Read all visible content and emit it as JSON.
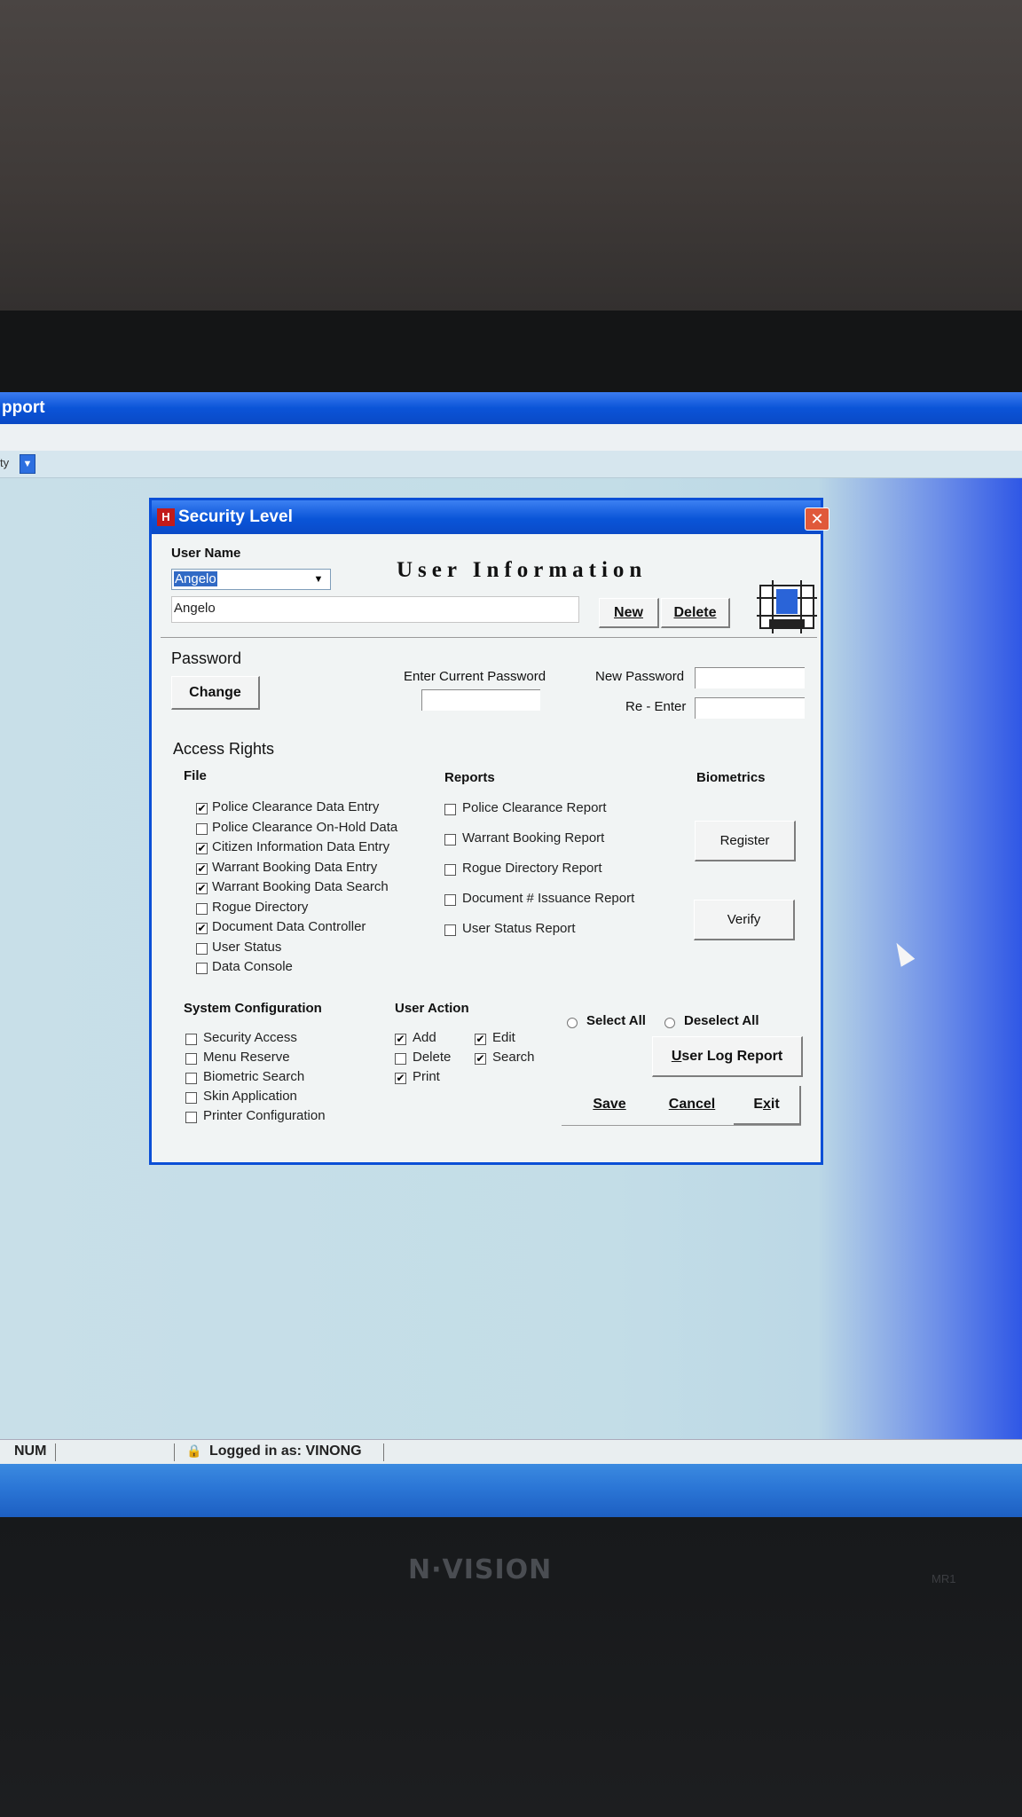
{
  "app": {
    "title": "pport",
    "toolbar_text": "ty",
    "toolbar_button_glyph": "▼"
  },
  "dialog": {
    "title": "Security Level",
    "close_glyph": "✕",
    "icon_glyph": "H",
    "user_name_label": "User Name",
    "user_name_selected": "Angelo",
    "user_name_field": "Angelo",
    "heading": "User Information",
    "new_button": "New",
    "delete_button": "Delete",
    "password_label": "Password",
    "change_button": "Change",
    "enter_current_password_label": "Enter Current Password",
    "new_password_label": "New Password",
    "reenter_label": "Re - Enter",
    "access_rights_label": "Access Rights",
    "file_label": "File",
    "reports_label": "Reports",
    "biometrics_label": "Biometrics",
    "register_button": "Register",
    "verify_button": "Verify",
    "file_items": [
      {
        "label": "Police Clearance Data Entry",
        "checked": true
      },
      {
        "label": "Police Clearance On-Hold Data",
        "checked": false
      },
      {
        "label": "Citizen Information Data Entry",
        "checked": true
      },
      {
        "label": "Warrant Booking Data Entry",
        "checked": true
      },
      {
        "label": "Warrant Booking Data Search",
        "checked": true
      },
      {
        "label": "Rogue Directory",
        "checked": false
      },
      {
        "label": "Document Data Controller",
        "checked": true
      },
      {
        "label": "User Status",
        "checked": false
      },
      {
        "label": "Data Console",
        "checked": false
      }
    ],
    "report_items": [
      {
        "label": "Police Clearance Report",
        "checked": false
      },
      {
        "label": "Warrant Booking Report",
        "checked": false
      },
      {
        "label": "Rogue Directory Report",
        "checked": false
      },
      {
        "label": "Document # Issuance Report",
        "checked": false
      },
      {
        "label": "User Status Report",
        "checked": false
      }
    ],
    "system_configuration_label": "System Configuration",
    "system_items": [
      {
        "label": "Security Access",
        "checked": false
      },
      {
        "label": "Menu Reserve",
        "checked": false
      },
      {
        "label": "Biometric Search",
        "checked": false
      },
      {
        "label": "Skin Application",
        "checked": false
      },
      {
        "label": "Printer Configuration",
        "checked": false
      }
    ],
    "user_action_label": "User Action",
    "user_actions": [
      {
        "label": "Add",
        "checked": true
      },
      {
        "label": "Edit",
        "checked": true
      },
      {
        "label": "Delete",
        "checked": false
      },
      {
        "label": "Search",
        "checked": true
      },
      {
        "label": "Print",
        "checked": true
      }
    ],
    "select_all_label": "Select All",
    "deselect_all_label": "Deselect All",
    "user_log_report_button_u": "U",
    "user_log_report_button_rest": "ser Log Report",
    "save_button_u": "S",
    "save_button_rest": "ave",
    "cancel_button_u": "C",
    "cancel_button_rest": "ancel",
    "exit_button_a": "E",
    "exit_button_u": "x",
    "exit_button_rest": "it"
  },
  "statusbar": {
    "num": "NUM",
    "lock_icon": "🔒",
    "logged_in": "Logged in as: VINONG"
  },
  "monitor": {
    "brand": "N·VISION",
    "model": "MR1"
  },
  "check_glyph": "✔"
}
